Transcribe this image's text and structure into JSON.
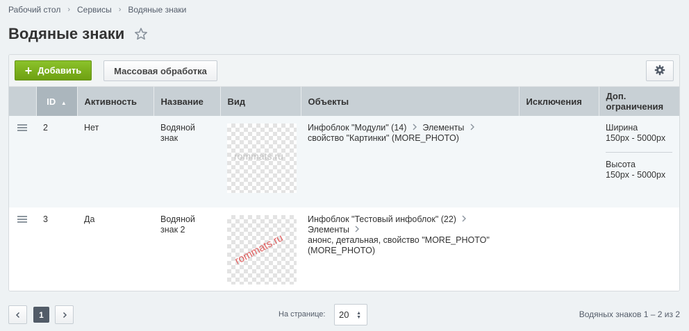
{
  "breadcrumb": [
    "Рабочий стол",
    "Сервисы",
    "Водяные знаки"
  ],
  "page_title": "Водяные знаки",
  "toolbar": {
    "add_label": "Добавить",
    "mass_label": "Массовая обработка"
  },
  "columns": {
    "id": "ID",
    "active": "Активность",
    "name": "Название",
    "view": "Вид",
    "objects": "Объекты",
    "exclusions": "Исключения",
    "limits": "Доп. ограничения"
  },
  "rows": [
    {
      "id": "2",
      "active": "Нет",
      "name": "Водяной знак",
      "watermark_text": "rommats.ru",
      "objects": {
        "iblock": "Инфоблок \"Модули\" (14)",
        "elements": "Элементы",
        "property": "свойство \"Картинки\" (MORE_PHOTO)"
      },
      "limits": [
        {
          "label": "Ширина",
          "value": "150px - 5000px"
        },
        {
          "label": "Высота",
          "value": "150px - 5000px"
        }
      ]
    },
    {
      "id": "3",
      "active": "Да",
      "name": "Водяной знак 2",
      "watermark_text": "rommats.ru",
      "objects": {
        "iblock": "Инфоблок \"Тестовый инфоблок\" (22)",
        "elements": "Элементы",
        "property": "анонс, детальная, свойство \"MORE_PHOTO\" (MORE_PHOTO)"
      }
    }
  ],
  "pagination": {
    "current_page": "1",
    "per_page_label": "На странице:",
    "per_page_value": "20",
    "total": "Водяных знаков 1 – 2 из 2"
  },
  "colors": {
    "accent_green": "#7ab51d",
    "header_bg": "#c8d0d5",
    "sorted_header_bg": "#abb6bd"
  },
  "icons": [
    "chevron-right-icon",
    "star-icon",
    "plus-icon",
    "gear-icon",
    "drag-handle-icon",
    "sort-asc-icon",
    "chevron-left-icon",
    "select-arrows-icon"
  ]
}
